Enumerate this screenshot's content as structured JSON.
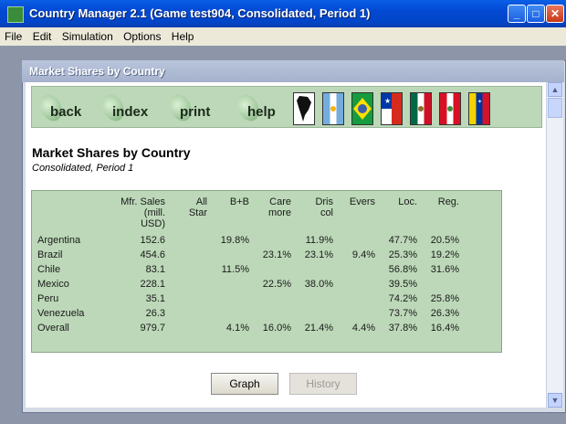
{
  "window": {
    "title": "Country Manager 2.1 (Game test904, Consolidated, Period 1)"
  },
  "window_buttons": {
    "minimize": "_",
    "maximize": "□",
    "close": "✕"
  },
  "menu": [
    "File",
    "Edit",
    "Simulation",
    "Options",
    "Help"
  ],
  "child_window": {
    "title": "Market Shares by Country"
  },
  "nav": {
    "back": "back",
    "index": "index",
    "print": "print",
    "help": "help"
  },
  "flags": [
    "south-america-map-icon",
    "argentina-flag-icon",
    "brazil-flag-icon",
    "chile-flag-icon",
    "mexico-flag-icon",
    "peru-flag-icon",
    "venezuela-flag-icon"
  ],
  "report": {
    "title": "Market Shares by Country",
    "subtitle": "Consolidated, Period 1",
    "columns": [
      [
        "Mfr. Sales",
        "(mill.",
        "USD)"
      ],
      [
        "All",
        "Star"
      ],
      [
        "B+B"
      ],
      [
        "Care",
        "more"
      ],
      [
        "Dris",
        "col"
      ],
      [
        "Evers"
      ],
      [
        "Loc."
      ],
      [
        "Reg."
      ]
    ],
    "rows": [
      {
        "country": "Argentina",
        "values": [
          "152.6",
          "",
          "19.8%",
          "",
          "11.9%",
          "",
          "47.7%",
          "20.5%"
        ]
      },
      {
        "country": "Brazil",
        "values": [
          "454.6",
          "",
          "",
          "23.1%",
          "23.1%",
          "9.4%",
          "25.3%",
          "19.2%"
        ]
      },
      {
        "country": "Chile",
        "values": [
          "83.1",
          "",
          "11.5%",
          "",
          "",
          "",
          "56.8%",
          "31.6%"
        ]
      },
      {
        "country": "Mexico",
        "values": [
          "228.1",
          "",
          "",
          "22.5%",
          "38.0%",
          "",
          "39.5%",
          ""
        ]
      },
      {
        "country": "Peru",
        "values": [
          "35.1",
          "",
          "",
          "",
          "",
          "",
          "74.2%",
          "25.8%"
        ]
      },
      {
        "country": "Venezuela",
        "values": [
          "26.3",
          "",
          "",
          "",
          "",
          "",
          "73.7%",
          "26.3%"
        ]
      },
      {
        "country": "Overall",
        "values": [
          "979.7",
          "",
          "4.1%",
          "16.0%",
          "21.4%",
          "4.4%",
          "37.8%",
          "16.4%"
        ]
      }
    ]
  },
  "buttons": {
    "graph": "Graph",
    "history": "History"
  },
  "scroll": {
    "up": "▲",
    "down": "▼"
  },
  "colors": {
    "panel_green": "#bcd8b8",
    "title_blue": "#0248d2"
  }
}
